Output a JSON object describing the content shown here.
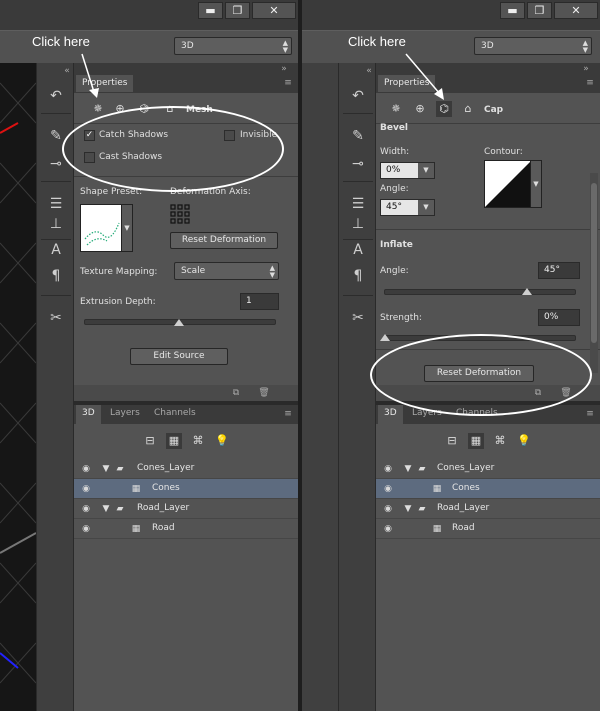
{
  "left": {
    "callout": "Click here",
    "mode_select": "3D",
    "properties_tab": "Properties",
    "section_title": "Mesh",
    "catch_shadows": {
      "label": "Catch Shadows",
      "checked": true
    },
    "invisible": {
      "label": "Invisible",
      "checked": false
    },
    "cast_shadows": {
      "label": "Cast Shadows",
      "checked": false
    },
    "shape_preset_label": "Shape Preset:",
    "deformation_axis_label": "Deformation Axis:",
    "reset_deformation": "Reset Deformation",
    "texture_mapping_label": "Texture Mapping:",
    "texture_mapping_value": "Scale",
    "extrusion_depth_label": "Extrusion Depth:",
    "extrusion_depth_value": "1",
    "edit_source": "Edit Source"
  },
  "right": {
    "callout": "Click here",
    "mode_select": "3D",
    "properties_tab": "Properties",
    "section_title": "Cap",
    "bevel_label": "Bevel",
    "width_label": "Width:",
    "width_value": "0%",
    "contour_label": "Contour:",
    "angle_label": "Angle:",
    "angle_value": "45°",
    "inflate_label": "Inflate",
    "inflate_angle_label": "Angle:",
    "inflate_angle_value": "45°",
    "strength_label": "Strength:",
    "strength_value": "0%",
    "reset_deformation": "Reset Deformation"
  },
  "layers_panel": {
    "tabs": [
      "3D",
      "Layers",
      "Channels"
    ],
    "rows": [
      {
        "name": "Cones_Layer",
        "type": "group"
      },
      {
        "name": "Cones",
        "type": "mesh",
        "selected": true
      },
      {
        "name": "Road_Layer",
        "type": "group"
      },
      {
        "name": "Road",
        "type": "mesh"
      }
    ]
  },
  "window_buttons": {
    "minimize": "▬",
    "restore": "❐",
    "close": "✕"
  },
  "colors": {
    "panel": "#535353",
    "selected_row": "#5d6b7f",
    "highlight": "#ffffff"
  }
}
